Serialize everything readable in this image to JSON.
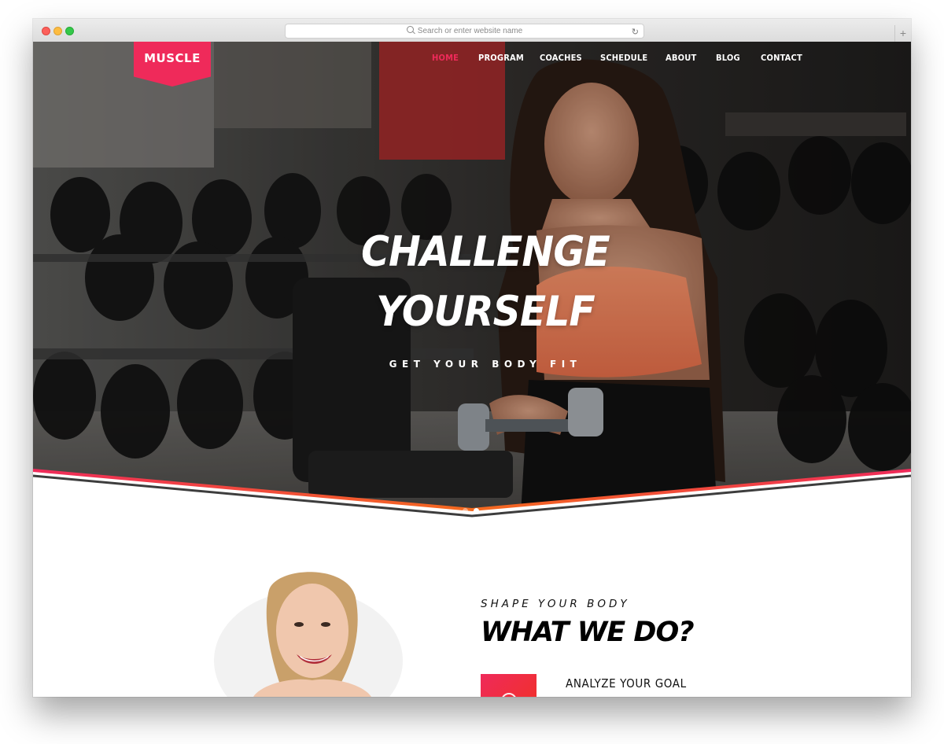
{
  "browser": {
    "url_placeholder": "Search or enter website name"
  },
  "site": {
    "logo": "MUSCLE",
    "nav": [
      {
        "label": "HOME",
        "active": true
      },
      {
        "label": "PROGRAM",
        "active": false
      },
      {
        "label": "COACHES",
        "active": false
      },
      {
        "label": "SCHEDULE",
        "active": false
      },
      {
        "label": "ABOUT",
        "active": false
      },
      {
        "label": "BLOG",
        "active": false
      },
      {
        "label": "CONTACT",
        "active": false
      }
    ],
    "accent_color": "#ef2a5a",
    "accent_color_2": "#f26a1b"
  },
  "hero": {
    "headline_line1": "CHALLENGE",
    "headline_line2": "YOURSELF",
    "subline": "GET YOUR BODY FIT",
    "slides_total": 2,
    "slide_active": 2
  },
  "about": {
    "eyebrow": "SHAPE YOUR BODY",
    "title": "WHAT WE DO?",
    "features": [
      {
        "title": "ANALYZE YOUR GOAL",
        "icon": "target-icon"
      }
    ]
  }
}
